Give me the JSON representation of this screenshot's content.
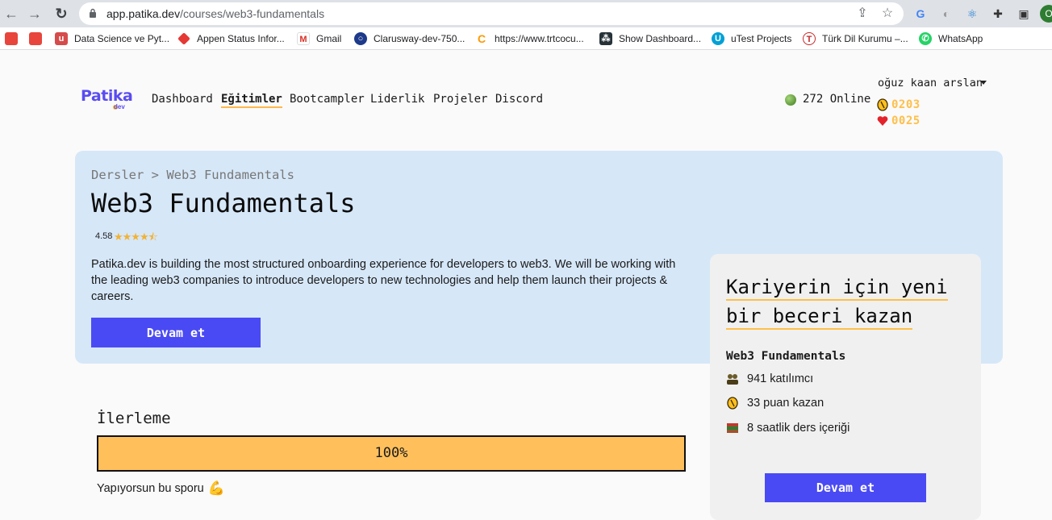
{
  "browser": {
    "url_host": "app.patika.dev",
    "url_path": "/courses/web3-fundamentals",
    "avatar_letter": "O",
    "bookmarks": [
      {
        "label": "",
        "icon": "chrome-icon",
        "color": "#e8453c"
      },
      {
        "label": "",
        "icon": "chrome-icon",
        "color": "#e8453c"
      },
      {
        "label": "Data Science ve Pyt...",
        "icon": "udemy-icon",
        "color": "#d64b4b"
      },
      {
        "label": "Appen Status Infor...",
        "icon": "appen-icon",
        "color": "#e53935"
      },
      {
        "label": "Gmail",
        "icon": "gmail-icon",
        "color": "#d93025"
      },
      {
        "label": "Clarusway-dev-750...",
        "icon": "clarusway-icon",
        "color": "#1e3a8a"
      },
      {
        "label": "https://www.trtcocu...",
        "icon": "trt-icon",
        "color": "#ff9800"
      },
      {
        "label": "Show Dashboard...",
        "icon": "dashboard-icon",
        "color": "#263238"
      },
      {
        "label": "uTest Projects",
        "icon": "utest-icon",
        "color": "#00a0d6"
      },
      {
        "label": "Türk Dil Kurumu –...",
        "icon": "tdk-icon",
        "color": "#c62828"
      },
      {
        "label": "WhatsApp",
        "icon": "whatsapp-icon",
        "color": "#25d366"
      }
    ]
  },
  "header": {
    "logo_text": "Patika",
    "logo_sub": "dev",
    "nav": [
      "Dashboard",
      "Eğitimler",
      "Bootcampler",
      "Liderlik",
      "Projeler",
      "Discord"
    ],
    "online": "272 Online",
    "username": "oğuz kaan arslan",
    "coins": "0203",
    "hearts": "0025"
  },
  "hero": {
    "breadcrumb": "Dersler > Web3 Fundamentals",
    "title": "Web3 Fundamentals",
    "rating": "4.58",
    "stars": 4.5,
    "description": "Patika.dev is building the most structured onboarding experience for developers to web3. We will be working with the leading web3 companies to introduce developers to new technologies and help them launch their projects & careers.",
    "button": "Devam et"
  },
  "side_card": {
    "title_line1": "Kariyerin için yeni",
    "title_line2": "bir beceri kazan",
    "course": "Web3 Fundamentals",
    "participants": "941 katılımcı",
    "points": "33 puan kazan",
    "hours": "8 saatlik ders içeriği",
    "button": "Devam et"
  },
  "progress": {
    "label": "İlerleme",
    "value": 100,
    "text": "100%",
    "note": "Yapıyorsun bu sporu"
  },
  "colors": {
    "accent": "#4a4af4",
    "hero_bg": "#d6e7f8",
    "progress_fill": "#ffc05c",
    "coin": "#ffbf4a"
  }
}
